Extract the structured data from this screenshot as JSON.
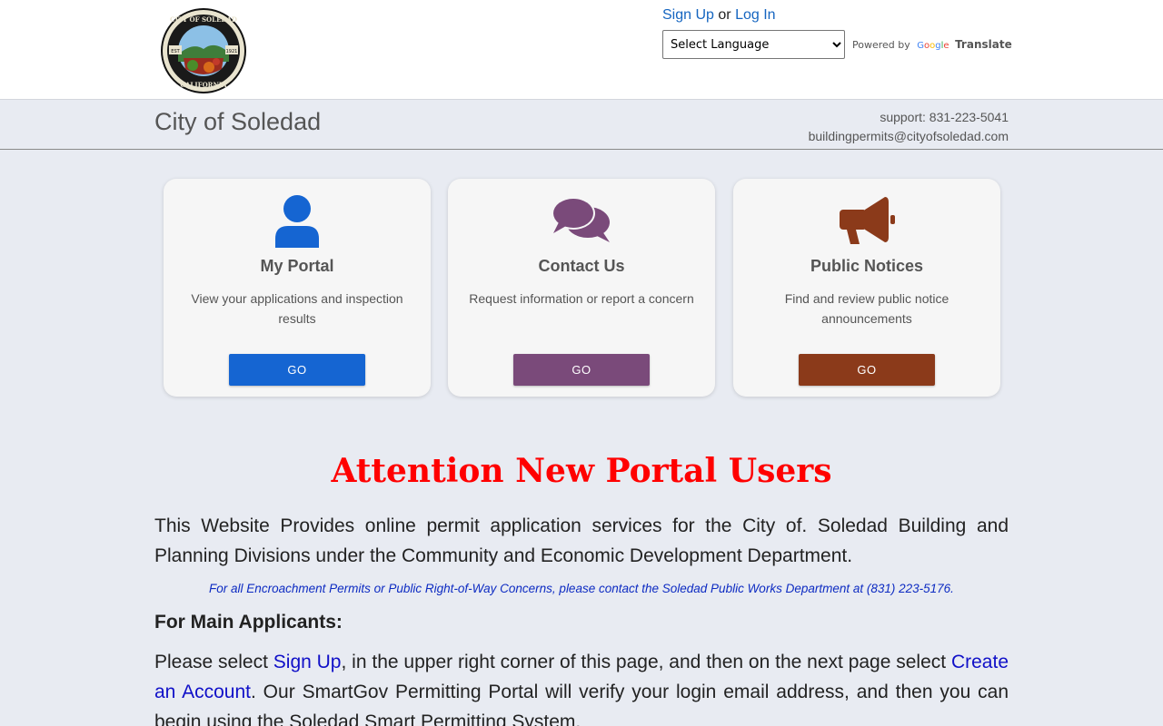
{
  "header": {
    "logo": {
      "top_text": "CITY OF SOLEDAD",
      "bottom_text": "CALIFORNIA",
      "est": "EST",
      "year": "1921"
    },
    "auth": {
      "sign_up": "Sign Up",
      "or": "or",
      "log_in": "Log In"
    },
    "language_select": {
      "selected": "Select Language"
    },
    "powered_by": "Powered by",
    "translate": "Translate"
  },
  "subheader": {
    "title": "City of Soledad",
    "support_phone": "support: 831-223-5041",
    "support_email": "buildingpermits@cityofsoledad.com"
  },
  "cards": [
    {
      "title": "My Portal",
      "description": "View your applications and inspection results",
      "button": "GO",
      "color": "#1565d2",
      "icon": "user-icon"
    },
    {
      "title": "Contact Us",
      "description": "Request information or report a concern",
      "button": "GO",
      "color": "#7a4a7a",
      "icon": "comments-icon"
    },
    {
      "title": "Public Notices",
      "description": "Find and review public notice announcements",
      "button": "GO",
      "color": "#8b3a1a",
      "icon": "megaphone-icon"
    }
  ],
  "content": {
    "attention": "Attention New Portal Users",
    "intro": "This Website Provides online permit application services for the City of. Soledad Building and Planning Divisions under the Community and Economic Development Department.",
    "note": "For all Encroachment Permits or Public Right-of-Way Concerns, please contact the Soledad Public Works Department at (831) 223-5176.",
    "main_applicants_heading": "For Main Applicants:",
    "instructions": {
      "part1": "Please select ",
      "link1": "Sign Up",
      "part2": ", in the upper right corner of this page, and then on the next page select ",
      "link2": "Create an Account",
      "part3": ". Our SmartGov Permitting Portal will verify your login email address, and then you can begin using the Soledad Smart Permitting System."
    }
  }
}
